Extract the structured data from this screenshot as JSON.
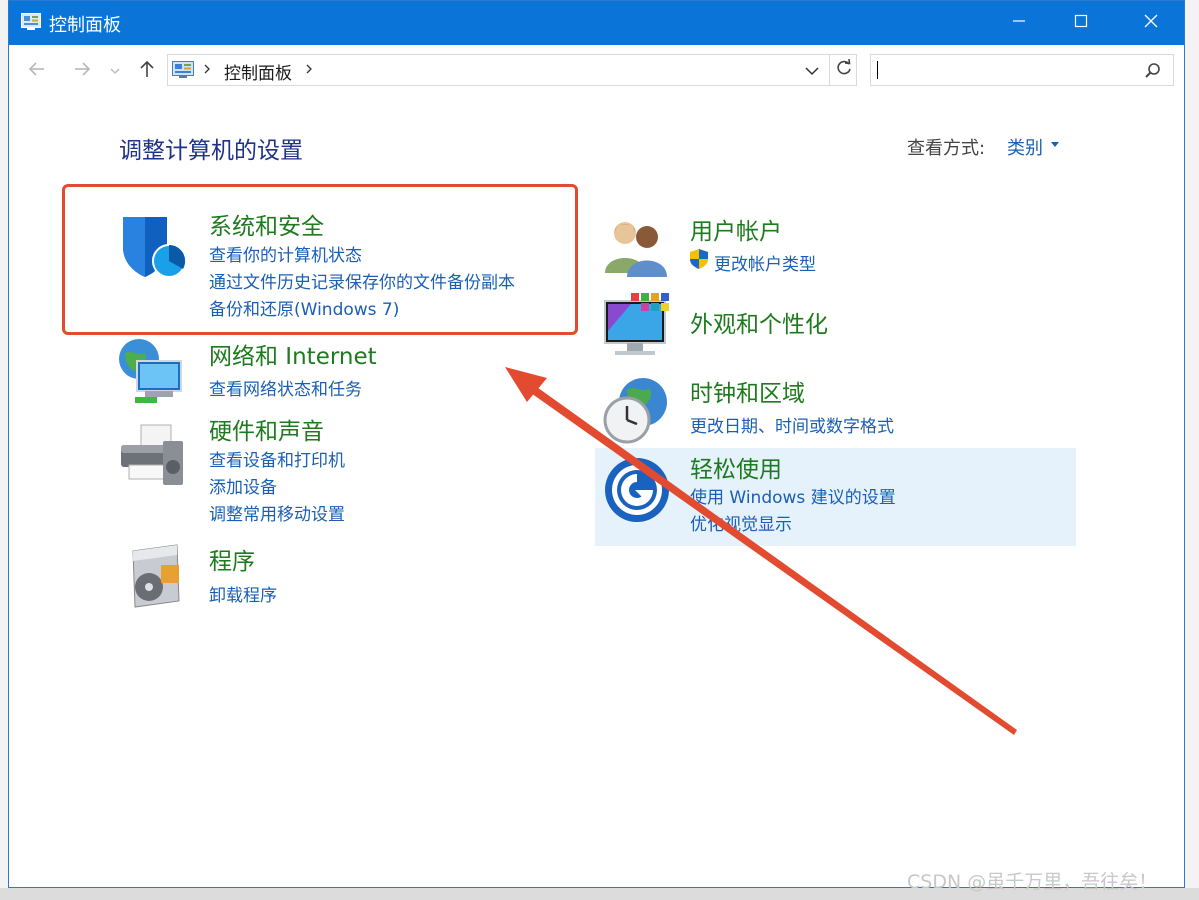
{
  "window": {
    "title": "控制面板",
    "minimize_icon": "minimize-icon",
    "maximize_icon": "maximize-icon",
    "close_icon": "close-icon"
  },
  "navbar": {
    "breadcrumb": "控制面板",
    "breadcrumb_icon": "control-panel-icon"
  },
  "content": {
    "heading": "调整计算机的设置",
    "view_by_label": "查看方式:",
    "view_by_value": "类别"
  },
  "categories": [
    {
      "title": "系统和安全",
      "icon": "shield-icon",
      "links": [
        "查看你的计算机状态",
        "通过文件历史记录保存你的文件备份副本",
        "备份和还原(Windows 7)"
      ]
    },
    {
      "title": "网络和 Internet",
      "icon": "network-icon",
      "links": [
        "查看网络状态和任务"
      ]
    },
    {
      "title": "硬件和声音",
      "icon": "printer-icon",
      "links": [
        "查看设备和打印机",
        "添加设备",
        "调整常用移动设置"
      ]
    },
    {
      "title": "程序",
      "icon": "programs-icon",
      "links": [
        "卸载程序"
      ]
    },
    {
      "title": "用户帐户",
      "icon": "users-icon",
      "links": [
        "更改帐户类型"
      ]
    },
    {
      "title": "外观和个性化",
      "icon": "appearance-icon",
      "links": []
    },
    {
      "title": "时钟和区域",
      "icon": "clock-icon",
      "links": [
        "更改日期、时间或数字格式"
      ]
    },
    {
      "title": "轻松使用",
      "icon": "ease-of-access-icon",
      "links": [
        "使用 Windows 建议的设置",
        "优化视觉显示"
      ]
    }
  ],
  "colors": {
    "titlebar": "#0a74d8",
    "category_title": "#1e7a1e",
    "link": "#1a5fb4",
    "annotation": "#e24b30",
    "hover": "#e5f1fb"
  },
  "watermark": "CSDN @虽千万里，吾往矣！"
}
